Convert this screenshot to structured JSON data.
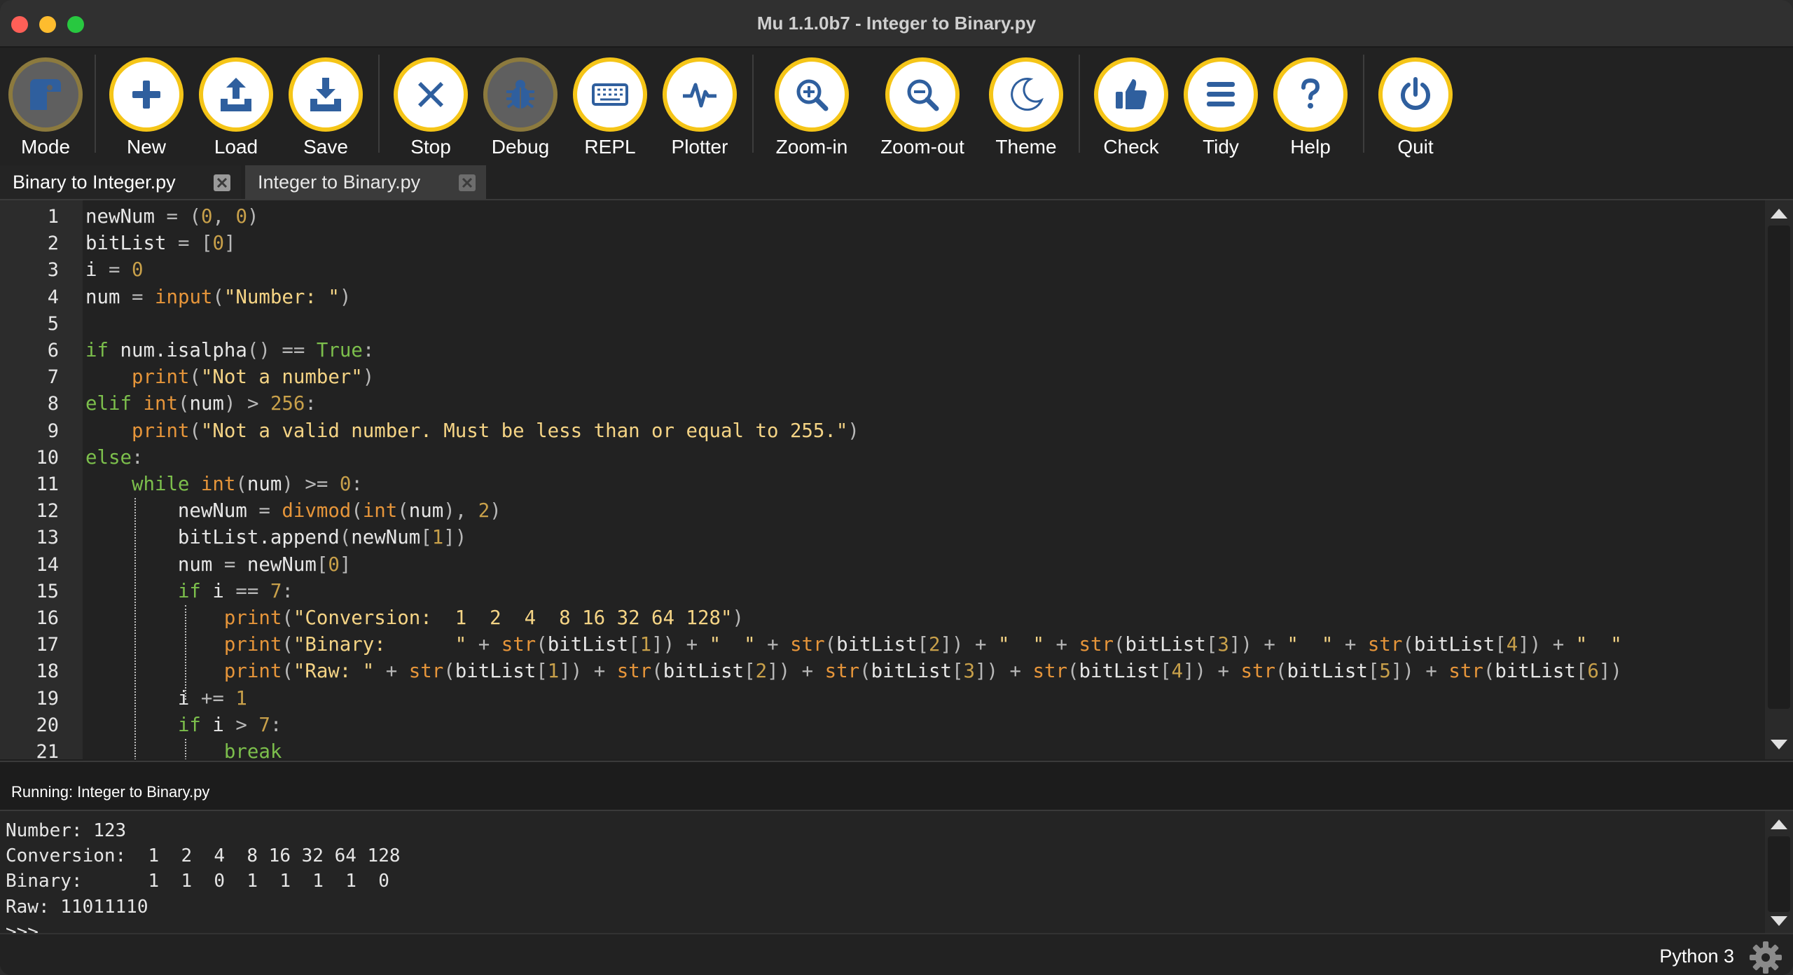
{
  "window": {
    "title": "Mu 1.1.0b7 - Integer to Binary.py"
  },
  "toolbar": {
    "buttons": [
      {
        "id": "mode",
        "label": "Mode",
        "icon": "mode-icon"
      },
      {
        "id": "new",
        "label": "New",
        "icon": "plus-icon"
      },
      {
        "id": "load",
        "label": "Load",
        "icon": "upload-icon"
      },
      {
        "id": "save",
        "label": "Save",
        "icon": "download-icon"
      },
      {
        "id": "stop",
        "label": "Stop",
        "icon": "close-icon"
      },
      {
        "id": "debug",
        "label": "Debug",
        "icon": "bug-icon"
      },
      {
        "id": "repl",
        "label": "REPL",
        "icon": "keyboard-icon"
      },
      {
        "id": "plotter",
        "label": "Plotter",
        "icon": "pulse-icon"
      },
      {
        "id": "zoom_in",
        "label": "Zoom-in",
        "icon": "zoom-in-icon"
      },
      {
        "id": "zoom_out",
        "label": "Zoom-out",
        "icon": "zoom-out-icon"
      },
      {
        "id": "theme",
        "label": "Theme",
        "icon": "moon-icon"
      },
      {
        "id": "check",
        "label": "Check",
        "icon": "thumbs-up-icon"
      },
      {
        "id": "tidy",
        "label": "Tidy",
        "icon": "lines-icon"
      },
      {
        "id": "help",
        "label": "Help",
        "icon": "question-icon"
      },
      {
        "id": "quit",
        "label": "Quit",
        "icon": "power-icon"
      }
    ]
  },
  "tabs": [
    {
      "label": "Binary to Integer.py",
      "active": false
    },
    {
      "label": "Integer to Binary.py",
      "active": true
    }
  ],
  "editor": {
    "line_numbers": [
      "1",
      "2",
      "3",
      "4",
      "5",
      "6",
      "7",
      "8",
      "9",
      "10",
      "11",
      "12",
      "13",
      "14",
      "15",
      "16",
      "17",
      "18",
      "19",
      "20",
      "21"
    ],
    "lines": [
      "newNum = (0, 0)",
      "bitList = [0]",
      "i = 0",
      "num = input(\"Number: \")",
      "",
      "if num.isalpha() == True:",
      "    print(\"Not a number\")",
      "elif int(num) > 256:",
      "    print(\"Not a valid number. Must be less than or equal to 255.\")",
      "else:",
      "    while int(num) >= 0:",
      "        newNum = divmod(int(num), 2)",
      "        bitList.append(newNum[1])",
      "        num = newNum[0]",
      "        if i == 7:",
      "            print(\"Conversion:  1  2  4  8 16 32 64 128\")",
      "            print(\"Binary:      \" + str(bitList[1]) + \"  \" + str(bitList[2]) + \"  \" + str(bitList[3]) + \"  \" + str(bitList[4]) + \"  \"",
      "            print(\"Raw: \" + str(bitList[1]) + str(bitList[2]) + str(bitList[3]) + str(bitList[4]) + str(bitList[5]) + str(bitList[6])",
      "        i += 1",
      "        if i > 7:",
      "            break"
    ]
  },
  "output_pane": {
    "title": "Running: Integer to Binary.py",
    "lines": [
      "Number: 123",
      "Conversion:  1  2  4  8 16 32 64 128",
      "Binary:      1  1  0  1  1  1  1  0",
      "Raw: 11011110",
      ">>>"
    ]
  },
  "status": {
    "mode": "Python 3"
  },
  "colors": {
    "accent": "#f5c518",
    "icon_blue": "#2f5f9e",
    "keyword": "#7cbf4c",
    "builtin": "#e6953a",
    "string": "#f5d485",
    "number": "#c8a04a"
  }
}
